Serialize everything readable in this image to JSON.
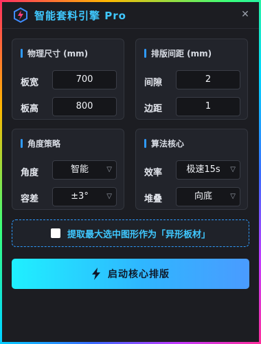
{
  "window": {
    "title": "智能套料引擎 Pro",
    "close_label": "✕"
  },
  "panels": {
    "size": {
      "title": "物理尺寸 (mm)",
      "rows": [
        {
          "label": "板宽",
          "value": "700"
        },
        {
          "label": "板高",
          "value": "800"
        }
      ]
    },
    "spacing": {
      "title": "排版间距 (mm)",
      "rows": [
        {
          "label": "间隙",
          "value": "2"
        },
        {
          "label": "边距",
          "value": "1"
        }
      ]
    },
    "angle": {
      "title": "角度策略",
      "rows": [
        {
          "label": "角度",
          "value": "智能"
        },
        {
          "label": "容差",
          "value": "±3°"
        }
      ]
    },
    "algorithm": {
      "title": "算法核心",
      "rows": [
        {
          "label": "效率",
          "value": "极速15s"
        },
        {
          "label": "堆叠",
          "value": "向底"
        }
      ]
    }
  },
  "irregular_option": {
    "label": "提取最大选中图形作为「异形板材」",
    "checked": false
  },
  "start_button": {
    "label": "启动核心排版"
  },
  "colors": {
    "accent": "#3fc8ff",
    "button_start": "#1ff0ff",
    "button_end": "#4a9bff"
  }
}
